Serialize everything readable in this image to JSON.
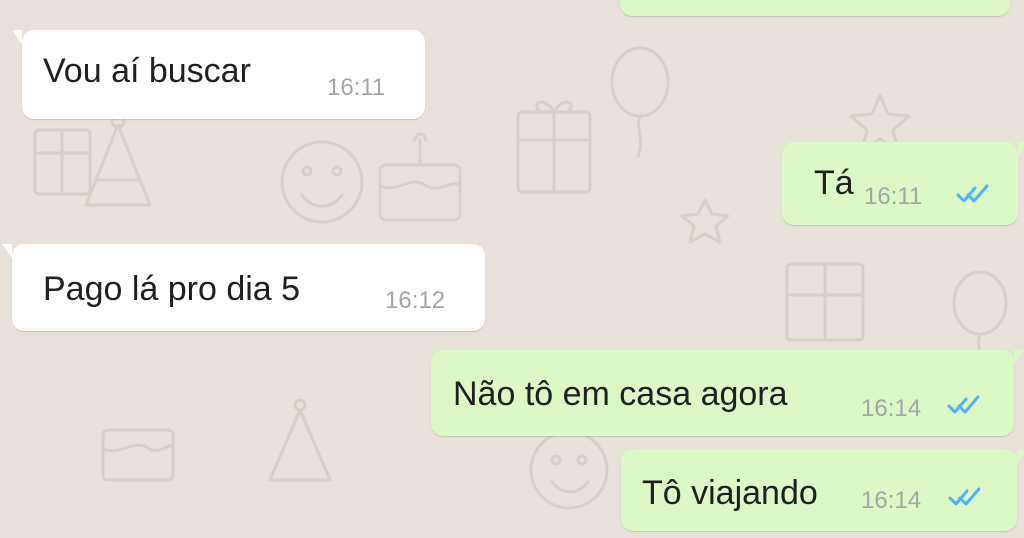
{
  "messages": [
    {
      "direction": "incoming",
      "text": "Vou aí buscar",
      "time": "16:11"
    },
    {
      "direction": "outgoing",
      "text": "Tá",
      "time": "16:11",
      "status": "read"
    },
    {
      "direction": "incoming",
      "text": "Pago lá pro dia 5",
      "time": "16:12"
    },
    {
      "direction": "outgoing",
      "text": "Não tô em casa agora",
      "time": "16:14",
      "status": "read"
    },
    {
      "direction": "outgoing",
      "text": "Tô viajando",
      "time": "16:14",
      "status": "read"
    }
  ],
  "colors": {
    "background": "#e7e1d9",
    "incoming_bubble": "#ffffff",
    "outgoing_bubble": "#dcf8c6",
    "timestamp": "#a5a5a5",
    "read_ticks": "#4fb3f6"
  },
  "icons": {
    "read_receipt": "double-check-icon",
    "wallpaper_items": [
      "party-hat-icon",
      "cake-icon",
      "gift-icon",
      "balloon-icon",
      "star-icon",
      "smile-icon"
    ]
  }
}
